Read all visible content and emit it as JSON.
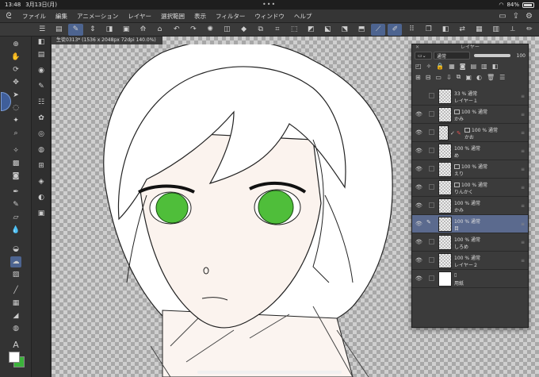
{
  "status_bar": {
    "time": "13:48",
    "date": "3月13日(月)",
    "battery": "84%"
  },
  "menu": {
    "items": [
      "ファイル",
      "編集",
      "アニメーション",
      "レイヤー",
      "選択範囲",
      "表示",
      "フィルター",
      "ウィンドウ",
      "ヘルプ"
    ]
  },
  "canvas": {
    "title": "生徒0313* (1536 x 2048px 72dpi 140.0%)"
  },
  "layer_panel": {
    "title": "レイヤー",
    "blend_mode": "通常",
    "opacity": "100",
    "opacity_fraction": 1.0,
    "layers": [
      {
        "opacity": "33 % 通常",
        "name": "レイヤー１",
        "selected": false,
        "visible": false,
        "type": "raster"
      },
      {
        "opacity": "100 % 通常",
        "name": "かみ",
        "selected": false,
        "visible": true,
        "type": "raster"
      },
      {
        "opacity": "100 % 通常",
        "name": "かお",
        "selected": false,
        "visible": true,
        "type": "raster"
      },
      {
        "opacity": "100 % 通常",
        "name": "め",
        "selected": false,
        "visible": true,
        "type": "raster"
      },
      {
        "opacity": "100 % 通常",
        "name": "えり",
        "selected": false,
        "visible": true,
        "type": "raster"
      },
      {
        "opacity": "100 % 通常",
        "name": "りんかく",
        "selected": false,
        "visible": true,
        "type": "raster"
      },
      {
        "opacity": "100 % 通常",
        "name": "かみ",
        "selected": false,
        "visible": true,
        "type": "raster"
      },
      {
        "opacity": "100 % 通常",
        "name": "目",
        "selected": true,
        "visible": true,
        "type": "raster"
      },
      {
        "opacity": "100 % 通常",
        "name": "しろめ",
        "selected": false,
        "visible": true,
        "type": "raster"
      },
      {
        "opacity": "100 % 通常",
        "name": "レイヤー２",
        "selected": false,
        "visible": true,
        "type": "raster"
      },
      {
        "opacity": "",
        "name": "用紙",
        "selected": false,
        "visible": true,
        "type": "paper"
      }
    ]
  },
  "colors": {
    "main": "#ffffff",
    "sub": "#3bb33b",
    "accent": "#4d6490",
    "eye": "#4fbe3a"
  }
}
